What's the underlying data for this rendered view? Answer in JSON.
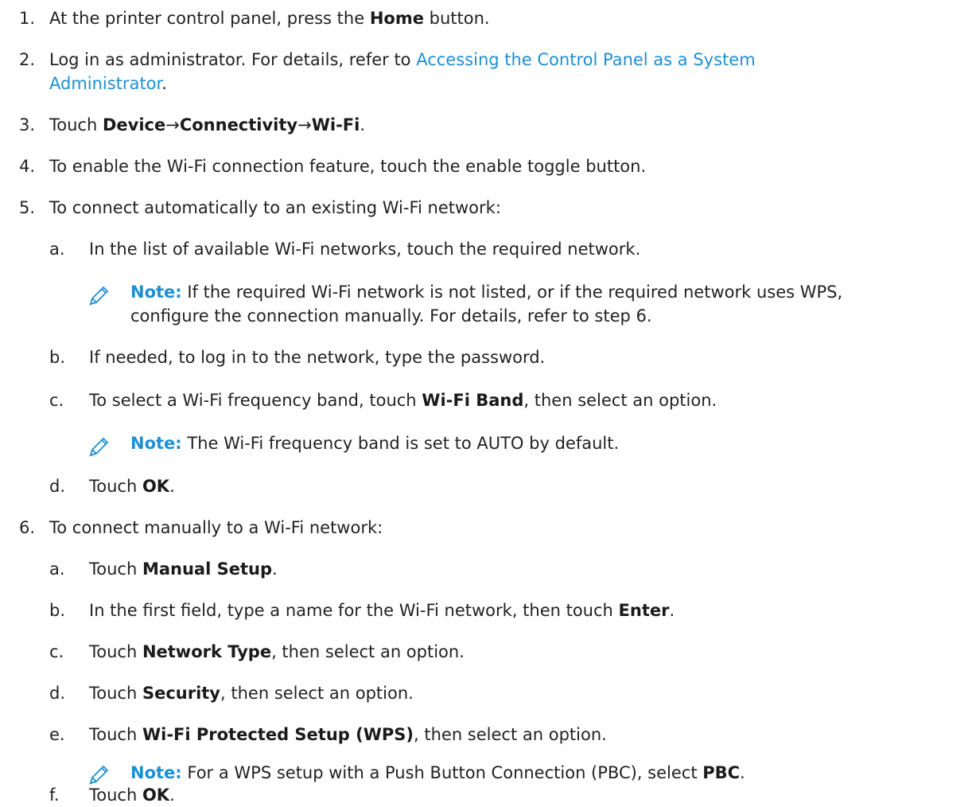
{
  "steps": [
    {
      "marker": "1.",
      "text_before": "At the printer control panel, press the ",
      "bold": "Home",
      "text_after": " button."
    },
    {
      "marker": "2.",
      "text_before": "Log in as administrator. For details, refer to ",
      "link_line1": "Accessing the Control Panel as a System",
      "link_line2": "Administrator",
      "text_after": "."
    },
    {
      "marker": "3.",
      "text_before": "Touch ",
      "bold1": "Device",
      "arrow1": "→",
      "bold2": "Connectivity",
      "arrow2": "→",
      "bold3": "Wi-Fi",
      "text_after": "."
    },
    {
      "marker": "4.",
      "text": "To enable the Wi-Fi connection feature, touch the enable toggle button."
    },
    {
      "marker": "5.",
      "text": "To connect automatically to an existing Wi-Fi network:",
      "sub": [
        {
          "marker": "a.",
          "text": "In the list of available Wi-Fi networks, touch the required network."
        },
        {
          "marker": "b.",
          "text": "If needed, to log in to the network, type the password."
        },
        {
          "marker": "c.",
          "text_before": "To select a Wi-Fi frequency band, touch ",
          "bold": "Wi-Fi Band",
          "text_after": ", then select an option."
        },
        {
          "marker": "d.",
          "text_before": "Touch ",
          "bold": "OK",
          "text_after": "."
        }
      ]
    },
    {
      "marker": "6.",
      "text": "To connect manually to a Wi-Fi network:",
      "sub": [
        {
          "marker": "a.",
          "text_before": "Touch ",
          "bold": "Manual Setup",
          "text_after": "."
        },
        {
          "marker": "b.",
          "text_before": "In the first field, type a name for the Wi-Fi network, then touch ",
          "bold": "Enter",
          "text_after": "."
        },
        {
          "marker": "c.",
          "text_before": "Touch ",
          "bold": "Network Type",
          "text_after": ", then select an option."
        },
        {
          "marker": "d.",
          "text_before": "Touch ",
          "bold": "Security",
          "text_after": ", then select an option."
        },
        {
          "marker": "e.",
          "text_before": "Touch ",
          "bold": "Wi-Fi Protected Setup (WPS)",
          "text_after": ", then select an option."
        },
        {
          "marker": "f.",
          "text_before": "Touch ",
          "bold": "OK",
          "text_after": "."
        }
      ]
    }
  ],
  "notes": {
    "label": "Note:",
    "n1_line1": " If the required Wi-Fi network is not listed, or if the required network uses WPS,",
    "n1_line2": "configure the connection manually. For details, refer to step 6.",
    "n2": " The Wi-Fi frequency band is set to AUTO by default.",
    "n3_before": " For a WPS setup with a Push Button Connection (PBC), select ",
    "n3_bold": "PBC",
    "n3_after": "."
  },
  "icons": {
    "note": "pencil-icon"
  },
  "colors": {
    "link": "#1e8fd3",
    "text": "#222222"
  }
}
